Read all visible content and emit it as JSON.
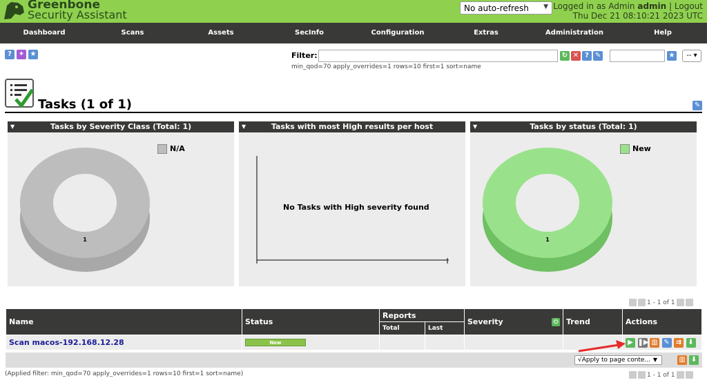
{
  "brand": {
    "line1": "Greenbone",
    "line2": "Security Assistant"
  },
  "auto_refresh": {
    "selected": "No auto-refresh"
  },
  "user": {
    "logged_in_as": "Logged in as",
    "role": "Admin",
    "username": "admin",
    "separator": "|",
    "logout": "Logout",
    "datetime": "Thu Dec 21 08:10:21 2023 UTC"
  },
  "nav": [
    "Dashboard",
    "Scans",
    "Assets",
    "SecInfo",
    "Configuration",
    "Extras",
    "Administration",
    "Help"
  ],
  "filter": {
    "label": "Filter:",
    "value": "",
    "applied": "min_qod=70 apply_overrides=1 rows=10 first=1 sort=name"
  },
  "page_title": "Tasks (1 of 1)",
  "panels": [
    {
      "title": "Tasks by Severity Class (Total: 1)",
      "legend": "N/A",
      "legend_color": "#bdbdbd",
      "donut_color": "#bdbdbd",
      "donut_side": "#a8a8a8",
      "donut_label": "1"
    },
    {
      "title": "Tasks with most High results per host",
      "message": "No Tasks with High severity found"
    },
    {
      "title": "Tasks by status (Total: 1)",
      "legend": "New",
      "legend_color": "#99e28b",
      "donut_color": "#99e28b",
      "donut_side": "#6fbf63",
      "donut_label": "1"
    }
  ],
  "table": {
    "headers": {
      "name": "Name",
      "status": "Status",
      "reports": "Reports",
      "total": "Total",
      "last": "Last",
      "severity": "Severity",
      "trend": "Trend",
      "actions": "Actions"
    },
    "rows": [
      {
        "name": "Scan macos-192.168.12.28",
        "status": "New",
        "total": "",
        "last": "",
        "severity": "",
        "trend": ""
      }
    ]
  },
  "pager": {
    "text": "1 - 1 of 1"
  },
  "bulk": {
    "apply_label": "√Apply to page conte..."
  },
  "applied_filter": "(Applied filter: min_qod=70 apply_overrides=1 rows=10 first=1 sort=name)",
  "colors": {
    "accent": "#8fd14f",
    "nav_bg": "#393937",
    "link": "#1c1c99"
  }
}
